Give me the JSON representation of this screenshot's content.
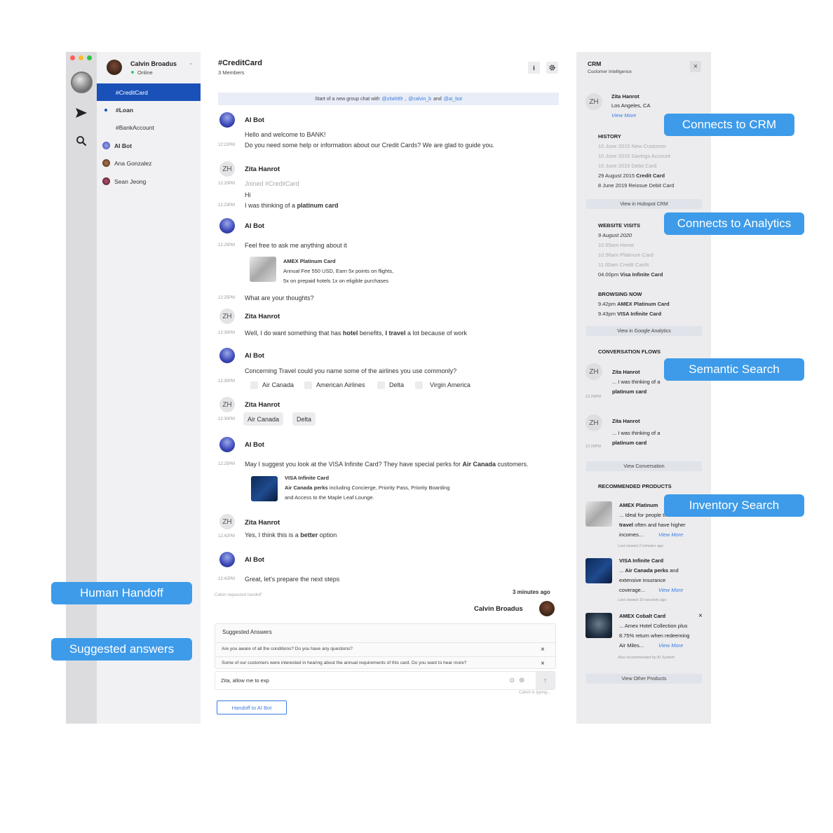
{
  "user": {
    "name": "Calvin Broadus",
    "status": "Online"
  },
  "channels": [
    {
      "label": "#CreditCard"
    },
    {
      "label": "#Loan"
    },
    {
      "label": "#BankAccount"
    }
  ],
  "contacts": [
    {
      "label": "AI Bot"
    },
    {
      "label": "Ana Gonzalez"
    },
    {
      "label": "Sean Jeong"
    }
  ],
  "chat": {
    "title": "#CreditCard",
    "members": "3 Members",
    "info_icon": "i",
    "banner": {
      "prefix": "Start of a new group chat with",
      "u1": "@zitah89",
      "sep1": ",",
      "u2": "@calvin_b",
      "and": "and",
      "u3": "@ai_bot"
    },
    "initials": "ZH",
    "bot_name": "AI Bot",
    "zh_name": "Zita Hanrot",
    "m1": {
      "l1": "Hello and welcome to BANK!",
      "time": "12:22PM",
      "l2": "Do you need some help or information about our Credit Cards? We are glad to guide you."
    },
    "m2": {
      "t1": "12:20PM",
      "joined": "Joined #CreditCard",
      "hi": "Hi",
      "t2": "12:23PM",
      "a": "I was thinking of a ",
      "b": "platinum card"
    },
    "m3": {
      "time": "12:25PM",
      "text": "Feel free to ask me anything about it",
      "card_title": "AMEX Platinum Card",
      "card_l1": "Annual Fee 550 USD, Earn 5x points on flights,",
      "card_l2": "5x on prepaid hotels 1x on eligible purchases",
      "t2": "12:25PM",
      "text2": "What are your thoughts?"
    },
    "m4": {
      "time": "12:30PM",
      "a": "Well, I do want something that has ",
      "b": "hotel",
      "c": " benefits, ",
      "d": "I travel",
      "e": " a lot because of work"
    },
    "m5": {
      "time": "12:30PM",
      "text": "Concerning Travel could you name some of the airlines you use commonly?",
      "options": [
        "Air Canada",
        "American Airlines",
        "Delta",
        "Virgin America"
      ]
    },
    "m6": {
      "time": "12:30PM",
      "chips": [
        "Air Canada",
        "Delta"
      ]
    },
    "m7": {
      "time": "12:25PM",
      "a": "May I suggest you look at the VISA Infinite Card? They have special perks for ",
      "b": "Air Canada",
      "c": " customers.",
      "card_title": "VISA Infinite Card",
      "card_b": "Air Canada perks",
      "card_l1": " including Concierge, Priority Pass, Priority Boarding",
      "card_l2": "and Access to the Maple Leaf Lounge."
    },
    "m8": {
      "time": "12:42PM",
      "a": "Yes, I think this is a ",
      "b": "better",
      "c": " option"
    },
    "m9": {
      "time": "12:42PM",
      "text": "Great, let's prepare the next steps"
    },
    "handoff_note": "Calvin requested handoff",
    "ago": "3 minutes ago",
    "agent": "Calvin Broadus",
    "suggested_title": "Suggested Answers",
    "suggested": [
      "Are you aware of all the conditions? Do you have any questions?",
      "Some of our customers were interested in hearing about the annual requirements of this card. Do you want to hear more?"
    ],
    "input_value": "Zita, allow me to exp",
    "typing": "Calvin is typing...",
    "handoff_button": "Handoff to AI Bot"
  },
  "crm": {
    "title": "CRM",
    "subtitle": "Customer Intelligence",
    "close": "×",
    "profile": {
      "initials": "ZH",
      "name": "Zita Hanrot",
      "location": "Los Angeles, CA",
      "more": "View More"
    },
    "history_title": "HISTORY",
    "history": [
      {
        "text": "10 June 2015 New Customer"
      },
      {
        "text": "10 June 2015 Savings Account"
      },
      {
        "text": "10 June 2015 Debit Card"
      },
      {
        "a": "29 August 2015 ",
        "b": "Credit Card"
      },
      {
        "a": "8 June 2019 Reissue Debit Card"
      }
    ],
    "hubspot_btn": "View in Hubspot CRM",
    "visits_title": "WEBSITE VISITS",
    "visit_date": "9 August 2020",
    "visits": [
      {
        "text": "10.55am Home"
      },
      {
        "text": "10.56am Platinum Card"
      },
      {
        "text": "11.00am Credit Cards"
      },
      {
        "a": "04.00pm ",
        "b": "Visa Infinite Card"
      }
    ],
    "browsing_title": "BROWSING NOW",
    "browsing": [
      {
        "a": "9.42pm ",
        "b": "AMEX Platinum Card"
      },
      {
        "a": "9.43pm ",
        "b": "VISA Infinite Card"
      }
    ],
    "ga_btn": "View in Google Analytics",
    "flows_title": "CONVERSATION FLOWS",
    "flows": [
      {
        "initials": "ZH",
        "name": "Zita Hanrot",
        "l1": "... I was thinking of a",
        "l2": "platinum card",
        "time": "12:25PM"
      },
      {
        "initials": "ZH",
        "name": "Zita Hanrot",
        "l1": "... I was thinking of a",
        "l2": "platinum card",
        "time": "12:25PM"
      }
    ],
    "conv_btn": "View Conversation",
    "products_title": "RECOMMENDED PRODUCTS",
    "products": [
      {
        "name": "AMEX Platinum",
        "l1": "... Ideal for people that",
        "l2a": "travel",
        "l2b": " often and have higher",
        "l3": "incomes...",
        "more": "View More",
        "note": "Last viewed 2 minutes ago"
      },
      {
        "name": "VISA Infinite Card",
        "l1a": "... ",
        "l1b": "Air Canada perks",
        "l1c": " and",
        "l2": "extensive insurance",
        "l3": "coverage...",
        "more": "View More",
        "note": "Last viewed 10 seconds ago"
      },
      {
        "name": "AMEX Cobalt Card",
        "l1": "... Amex Hotel Collection plus",
        "l2": "8.75% return when redeeming",
        "l3": "Air Miles...",
        "more": "View More",
        "note": "Also recommended by AI System"
      }
    ],
    "other_btn": "View Other Products"
  },
  "callouts": {
    "crm": "Connects to CRM",
    "analytics": "Connects to Analytics",
    "semantic": "Semantic Search",
    "inventory": "Inventory Search",
    "handoff": "Human Handoff",
    "suggested": "Suggested answers"
  },
  "colors": {
    "accent": "#1a51b8",
    "callout": "#3d9be9",
    "link": "#3a7be0",
    "online": "#2ecc71"
  }
}
